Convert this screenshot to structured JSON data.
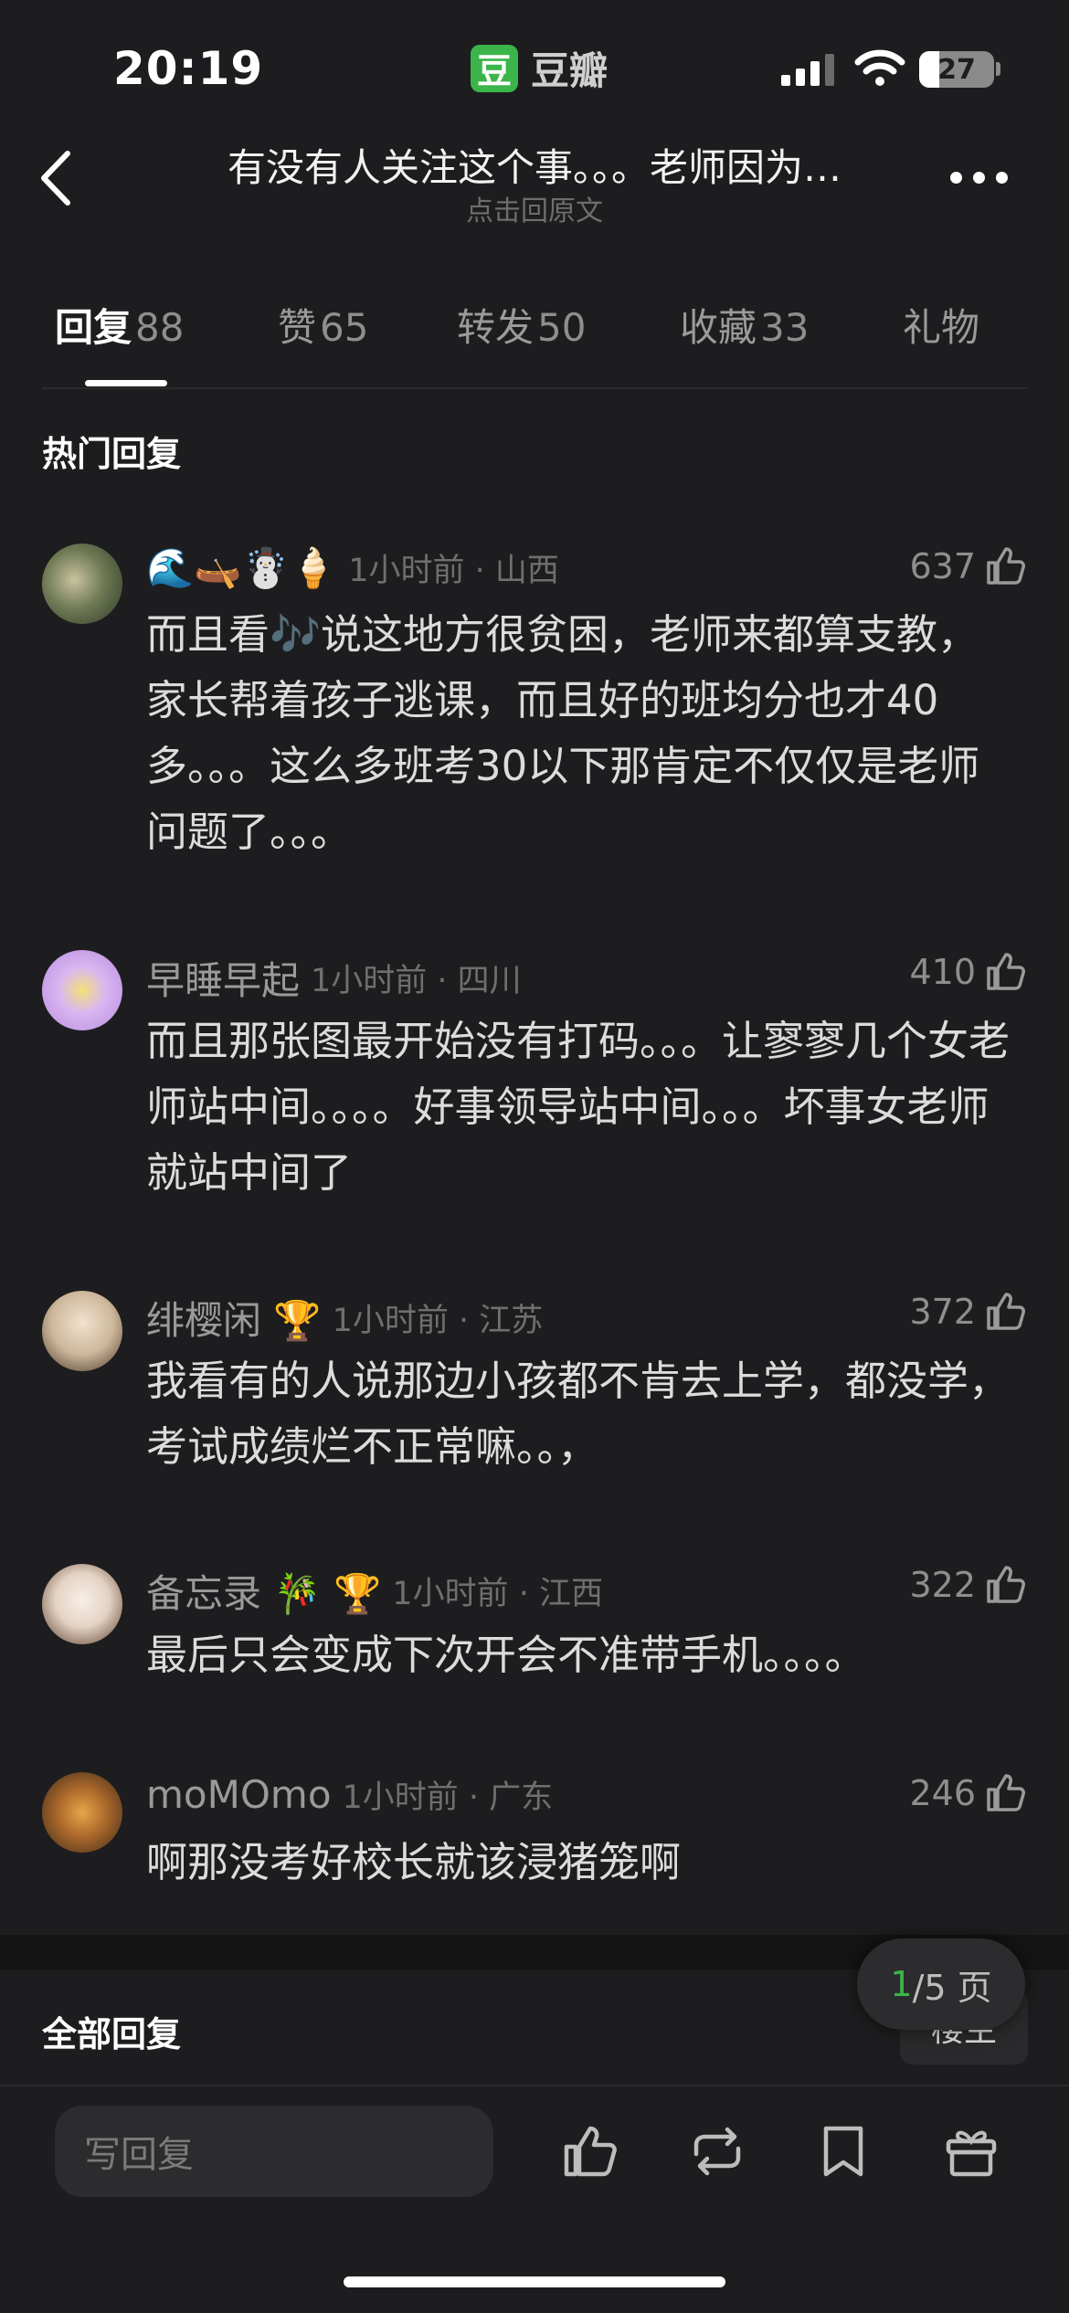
{
  "status_bar": {
    "time": "20:19",
    "app_logo": "豆",
    "app_name": "豆瓣",
    "battery": "27"
  },
  "nav": {
    "title": "有没有人关注这个事。。。老师因为…",
    "subtitle": "点击回原文"
  },
  "tabs": [
    {
      "label": "回复",
      "count": "88",
      "active": true
    },
    {
      "label": "赞",
      "count": "65",
      "active": false
    },
    {
      "label": "转发",
      "count": "50",
      "active": false
    },
    {
      "label": "收藏",
      "count": "33",
      "active": false
    },
    {
      "label": "礼物",
      "count": "",
      "active": false
    }
  ],
  "hot_heading": "热门回复",
  "comments": [
    {
      "name": "🌊🛶☃️🍦",
      "time": "1小时前 · 山西",
      "likes": "637",
      "text": "而且看🎶说这地方很贫困，老师来都算支教，家长帮着孩子逃课，而且好的班均分也才40多。。。这么多班考30以下那肯定不仅仅是老师问题了。。。",
      "avatar_color": "#4a5a3c"
    },
    {
      "name": "早睡早起",
      "time": "1小时前 · 四川",
      "likes": "410",
      "text": "而且那张图最开始没有打码。。。让寥寥几个女老师站中间。。。。好事领导站中间。。。坏事女老师就站中间了",
      "avatar_color": "#c8a6e8"
    },
    {
      "name": "绯樱闲 🏆",
      "time": "1小时前 · 江苏",
      "likes": "372",
      "text": "我看有的人说那边小孩都不肯去上学，都没学，考试成绩烂不正常嘛。。，",
      "avatar_color": "#d8cbb8"
    },
    {
      "name": "备忘录 🎋 🏆",
      "time": "1小时前 · 江西",
      "likes": "322",
      "text": "最后只会变成下次开会不准带手机。。。。",
      "avatar_color": "#f0e6dc"
    },
    {
      "name": "moMOmo",
      "time": "1小时前 · 广东",
      "likes": "246",
      "text": "啊那没考好校长就该浸猪笼啊",
      "avatar_color": "#8a5a2c"
    }
  ],
  "all_heading": "全部回复",
  "louzhu_label": "楼主",
  "pager": {
    "current": "1",
    "total_text": "/5 页"
  },
  "reply_placeholder": "写回复",
  "icons": [
    "back-icon",
    "more-icon",
    "like-icon",
    "repost-icon",
    "bookmark-icon",
    "gift-icon"
  ]
}
